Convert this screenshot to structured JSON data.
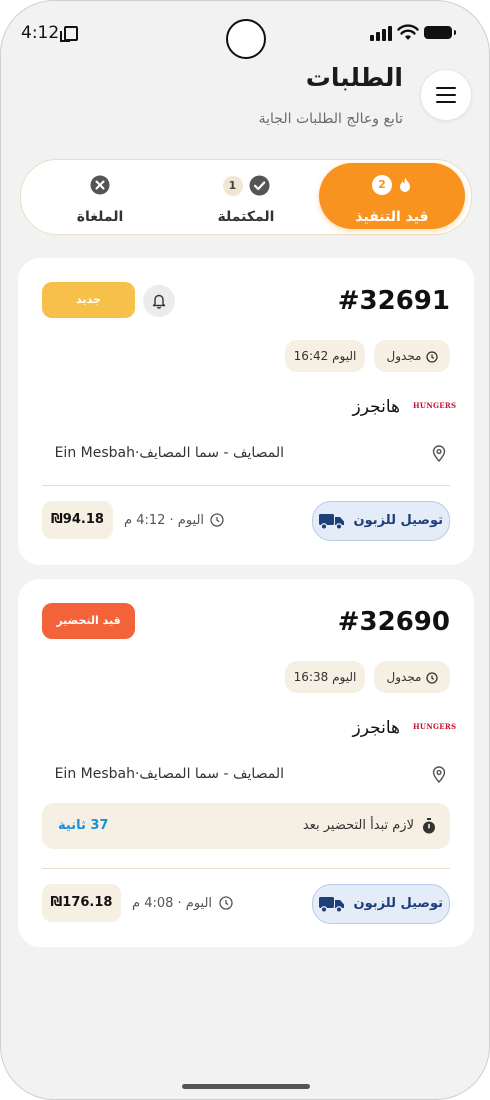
{
  "status_bar": {
    "time": "4:12"
  },
  "header": {
    "title": "الطلبات",
    "subtitle": "تابع وعالج الطلبات الجاية",
    "menu_icon": "hamburger-menu-icon"
  },
  "tabs": [
    {
      "label": "قيد التنفيذ",
      "count": "2",
      "icon": "fire-icon",
      "active": true
    },
    {
      "label": "المكتملة",
      "count": "1",
      "icon": "check-circle-icon",
      "active": false
    },
    {
      "label": "الملغاة",
      "count": "",
      "icon": "x-circle-icon",
      "active": false
    }
  ],
  "orders": [
    {
      "number": "#32691",
      "badge": {
        "label": "جديد",
        "color": "#f7c04a"
      },
      "scheduled_label": "مجدول",
      "scheduled_time": "اليوم 16:42",
      "restaurant_logo": "HUNGERS",
      "restaurant_name": "هانجرز",
      "address": "المصايف - سما المصايف·Ein Mesbah",
      "order_time": "اليوم · 4:12 م",
      "price": "₪94.18",
      "delivery_label": "توصيل للزبون"
    },
    {
      "number": "#32690",
      "badge": {
        "label": "قيد التحضير",
        "color": "#f4623a"
      },
      "scheduled_label": "مجدول",
      "scheduled_time": "اليوم 16:38",
      "restaurant_logo": "HUNGERS",
      "restaurant_name": "هانجرز",
      "address": "المصايف - سما المصايف·Ein Mesbah",
      "prep_note": "لازم تبدأ التحضير بعد",
      "prep_countdown": "37 ثانية",
      "order_time": "اليوم · 4:08 م",
      "price": "₪176.18",
      "delivery_label": "توصيل للزبون"
    }
  ],
  "colors": {
    "accent": "#f7931e",
    "background": "#f2f2f2",
    "delivery_text": "#1f3f7a",
    "countdown": "#1a8fd6"
  }
}
